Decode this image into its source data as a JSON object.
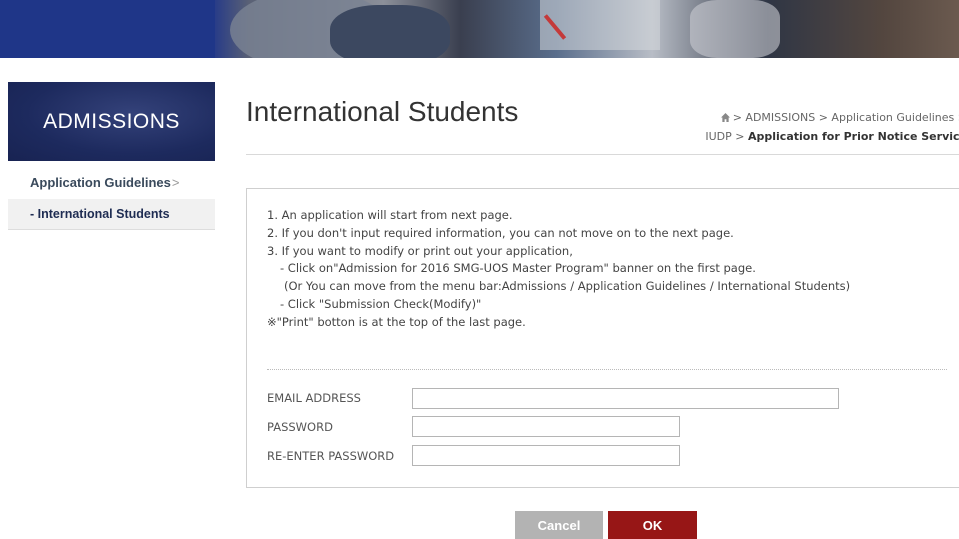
{
  "sidebar": {
    "heading": "ADMISSIONS",
    "items": [
      {
        "label": "Application Guidelines",
        "chevron": ">"
      },
      {
        "label": "- International Students"
      }
    ]
  },
  "page": {
    "title": "International Students"
  },
  "breadcrumb": {
    "line1": "> ADMISSIONS > Application Guidelines >",
    "line2_prefix": "IUDP >",
    "line2_current": "Application for Prior Notice Service"
  },
  "notes": [
    "1. An application will start from next page.",
    "2. If you don't input required information, you can not move on to the next page.",
    "3. If you want to modify or print out your application,",
    "- Click on\"Admission for 2016 SMG-UOS Master Program\" banner on the first page.",
    "(Or You can move from the menu bar:Admissions / Application Guidelines / International Students)",
    "- Click \"Submission Check(Modify)\"",
    "※\"Print\" botton is at the top of the last page."
  ],
  "form": {
    "email_label": "EMAIL ADDRESS",
    "email_value": "",
    "password_label": "PASSWORD",
    "password_value": "",
    "reenter_label": "RE-ENTER PASSWORD",
    "reenter_value": ""
  },
  "buttons": {
    "cancel": "Cancel",
    "ok": "OK"
  },
  "colors": {
    "sidebar_header": "#1d2a5e",
    "ok_button": "#971616",
    "cancel_button": "#b3b3b3"
  },
  "icons": {
    "home": "home-icon"
  }
}
